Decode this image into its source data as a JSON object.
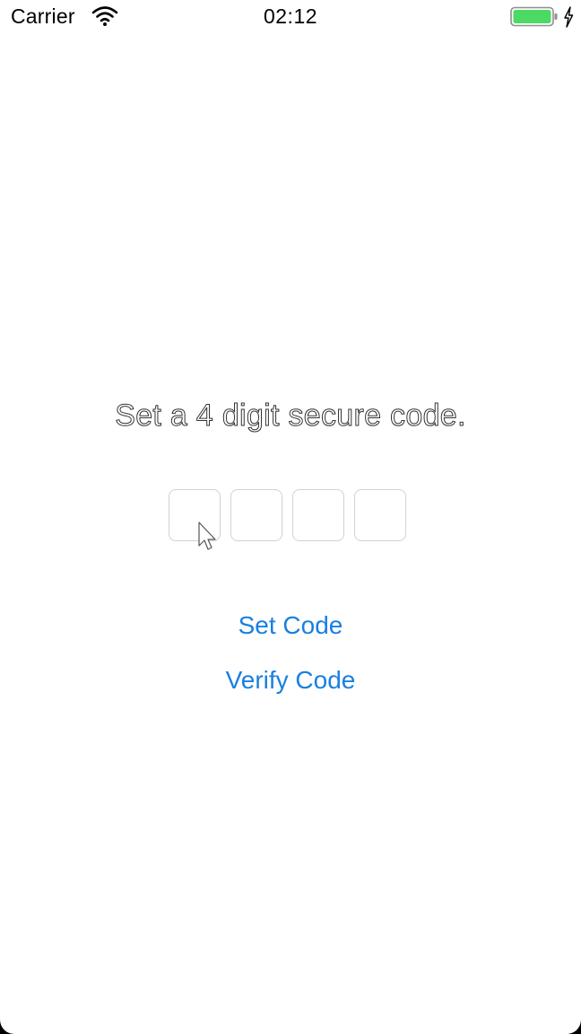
{
  "status_bar": {
    "carrier": "Carrier",
    "time": "02:12",
    "wifi_icon": "wifi-icon",
    "battery_icon": "battery-icon",
    "charging_icon": "charging-bolt-icon",
    "battery_color": "#4cd964"
  },
  "main": {
    "prompt": "Set a 4 digit secure code.",
    "code_boxes": [
      "",
      "",
      "",
      ""
    ],
    "set_code_label": "Set Code",
    "verify_code_label": "Verify Code"
  },
  "colors": {
    "accent": "#1a7fe0",
    "box_border": "#d2d2d2"
  }
}
